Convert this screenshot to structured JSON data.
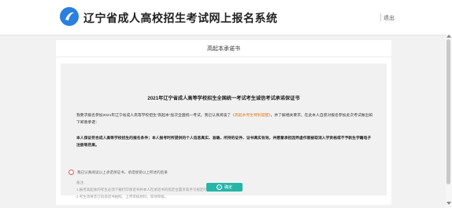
{
  "header": {
    "title": "辽宁省成人高校招生考试网上报名系统",
    "logout": "退出",
    "logo_icon": "swoosh-logo-icon",
    "brand_color": "#2b7fe0"
  },
  "card": {
    "title": "高起本承诺书",
    "notice_title": "2021年辽宁省成人高等学校招生全国统一考试考生诚信考试承诺保证书",
    "para1_prefix": "我要求报名参加2021年辽宁省成人高等学校招生“高起本”层次全国统一考试，我已认真阅读了",
    "para1_link": "《高起本考生特别提醒》",
    "para1_suffix": "，并了解相关要求。在此本人自愿对报名参加此次考试做出如下郑重承诺：",
    "para2_text": "本人保证符合成人高等学校招生的报名条件；本人报考时所提供的个人信息真实、准确，所持的证件、证书真实有效，并愿意承担因弄虚作假被取消入学资格或不予新生学籍电子注册等后果。",
    "note_label": "备注:",
    "note1": "1.报考高起本的考生必须下载打印承诺书并本人在承诺书的指定位置亲笔手写规定的承诺内容。",
    "note2": "2.考生须将签订的承诺书拍照，上传审核材料，等待审核。"
  },
  "agreement": {
    "label": "我已认真阅读以上承诺保证书，承诺接受以上所述的后果"
  },
  "confirm": {
    "label": "确定",
    "icon": "check-circle-icon",
    "color": "#26b5a7"
  }
}
